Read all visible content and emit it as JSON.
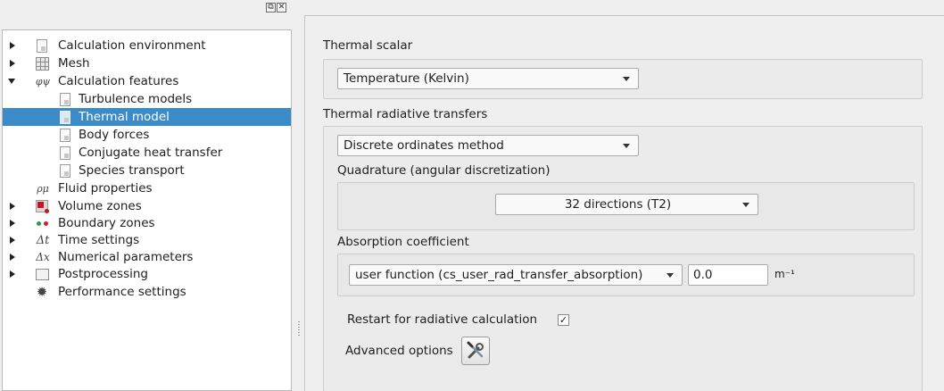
{
  "dock": {
    "float_glyph": "⧉",
    "close_glyph": "✕"
  },
  "tree": {
    "items": [
      {
        "label": "Calculation environment",
        "icon": "document-icon",
        "expanded": false
      },
      {
        "label": "Mesh",
        "icon": "mesh-icon",
        "expanded": false
      },
      {
        "label": "Calculation features",
        "icon": "phi-icon",
        "icon_text": "φψ",
        "expanded": true,
        "children": [
          {
            "label": "Turbulence models",
            "icon": "document-icon"
          },
          {
            "label": "Thermal model",
            "icon": "document-icon",
            "selected": true
          },
          {
            "label": "Body forces",
            "icon": "document-icon"
          },
          {
            "label": "Conjugate heat transfer",
            "icon": "document-icon"
          },
          {
            "label": "Species transport",
            "icon": "document-icon"
          }
        ]
      },
      {
        "label": "Fluid properties",
        "icon": "rho-mu-icon",
        "icon_text": "ρμ"
      },
      {
        "label": "Volume zones",
        "icon": "volume-icon",
        "expanded": false
      },
      {
        "label": "Boundary zones",
        "icon": "boundary-icon",
        "expanded": false
      },
      {
        "label": "Time settings",
        "icon": "delta-t-icon",
        "icon_text": "Δt",
        "expanded": false
      },
      {
        "label": "Numerical parameters",
        "icon": "delta-x-icon",
        "icon_text": "Δx",
        "expanded": false
      },
      {
        "label": "Postprocessing",
        "icon": "chart-icon",
        "expanded": false
      },
      {
        "label": "Performance settings",
        "icon": "gear-icon",
        "icon_text": "✹"
      }
    ]
  },
  "thermal_scalar": {
    "title": "Thermal scalar",
    "selected": "Temperature (Kelvin)"
  },
  "radiative": {
    "title": "Thermal radiative transfers",
    "method_selected": "Discrete ordinates method",
    "quadrature_title": "Quadrature (angular discretization)",
    "quadrature_selected": "32 directions (T2)",
    "absorption_title": "Absorption coefficient",
    "absorption_selected": "user function (cs_user_rad_transfer_absorption)",
    "absorption_value": "0.0",
    "absorption_unit": "m⁻¹",
    "restart_label": "Restart for radiative calculation",
    "restart_checked": "✓",
    "advanced_label": "Advanced options"
  },
  "colors": {
    "selection": "#3a8bc8"
  }
}
